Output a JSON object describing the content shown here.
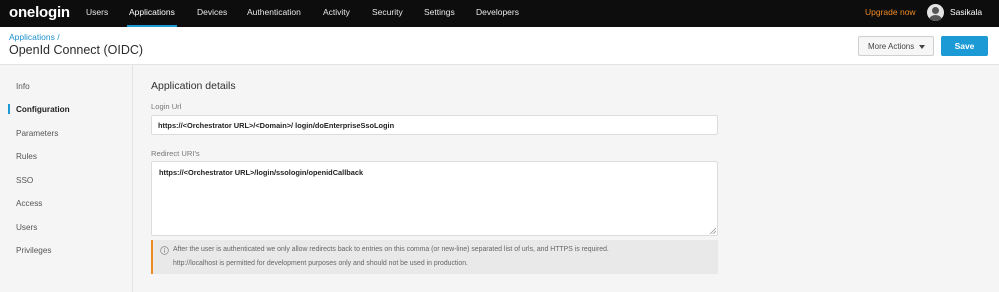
{
  "topnav": {
    "logo": "onelogin",
    "items": [
      {
        "label": "Users"
      },
      {
        "label": "Applications"
      },
      {
        "label": "Devices"
      },
      {
        "label": "Authentication"
      },
      {
        "label": "Activity"
      },
      {
        "label": "Security"
      },
      {
        "label": "Settings"
      },
      {
        "label": "Developers"
      }
    ],
    "active_item": "Applications",
    "upgrade_label": "Upgrade now",
    "user_name": "Sasikala"
  },
  "header": {
    "breadcrumb": "Applications /",
    "title": "OpenId Connect (OIDC)",
    "more_actions_label": "More Actions",
    "save_label": "Save"
  },
  "sidebar": {
    "items": [
      {
        "label": "Info"
      },
      {
        "label": "Configuration"
      },
      {
        "label": "Parameters"
      },
      {
        "label": "Rules"
      },
      {
        "label": "SSO"
      },
      {
        "label": "Access"
      },
      {
        "label": "Users"
      },
      {
        "label": "Privileges"
      }
    ],
    "active_item": "Configuration"
  },
  "main": {
    "section_title": "Application details",
    "login_url": {
      "label": "Login Url",
      "value": "https://<Orchestrator URL>/<Domain>/ login/doEnterpriseSsoLogin"
    },
    "redirect_uris": {
      "label": "Redirect URI's",
      "value": "https://<Orchestrator URL>/login/ssologin/openidCallback"
    },
    "notice": {
      "line1": "After the user is authenticated we only allow redirects back to entries on this comma (or new-line) separated list of urls, and HTTPS is required.",
      "line2": "http://localhost is permitted for development purposes only and should not be used in production."
    }
  },
  "colors": {
    "nav_bg": "#0d0d0d",
    "accent": "#1b9ad6",
    "upgrade": "#f08a24",
    "page_bg": "#f5f5f5"
  },
  "icons": {
    "avatar": "user-avatar-icon",
    "dropdown": "caret-down-icon",
    "info": "info-circle-icon",
    "resize": "resize-handle-icon"
  }
}
